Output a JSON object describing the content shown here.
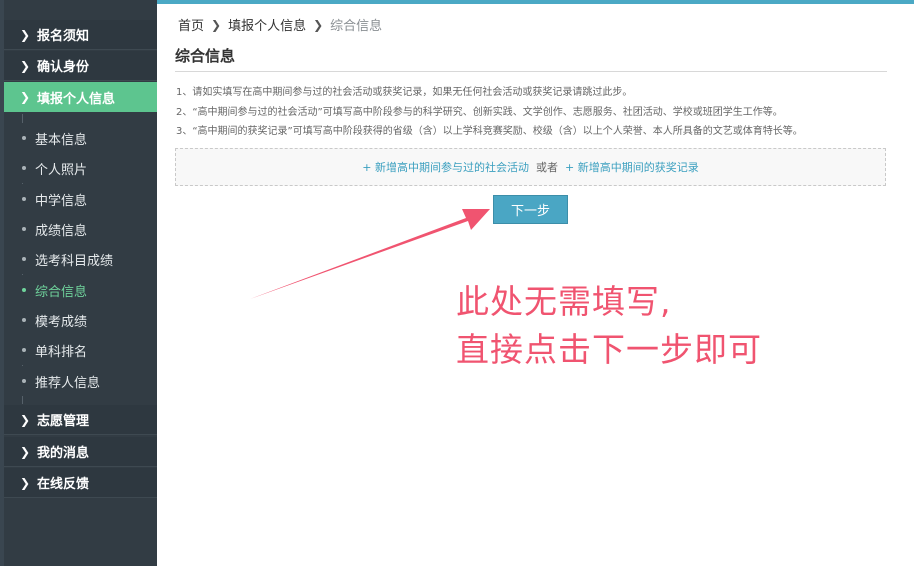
{
  "sidebar": {
    "items": [
      {
        "label": "报名须知",
        "type": "section",
        "active": false
      },
      {
        "label": "确认身份",
        "type": "section",
        "active": false
      },
      {
        "label": "填报个人信息",
        "type": "section",
        "active": true
      },
      {
        "label": "基本信息",
        "type": "sub",
        "current": false
      },
      {
        "label": "个人照片",
        "type": "sub",
        "current": false
      },
      {
        "label": "中学信息",
        "type": "sub",
        "current": false
      },
      {
        "label": "成绩信息",
        "type": "sub",
        "current": false
      },
      {
        "label": "选考科目成绩",
        "type": "sub",
        "current": false
      },
      {
        "label": "综合信息",
        "type": "sub",
        "current": true
      },
      {
        "label": "模考成绩",
        "type": "sub",
        "current": false
      },
      {
        "label": "单科排名",
        "type": "sub",
        "current": false
      },
      {
        "label": "推荐人信息",
        "type": "sub",
        "current": false
      },
      {
        "label": "志愿管理",
        "type": "section",
        "active": false
      },
      {
        "label": "我的消息",
        "type": "section",
        "active": false
      },
      {
        "label": "在线反馈",
        "type": "section",
        "active": false
      }
    ]
  },
  "breadcrumb": {
    "home": "首页",
    "parent": "填报个人信息",
    "current": "综合信息"
  },
  "page": {
    "title": "综合信息",
    "notes": [
      "1、请如实填写在高中期间参与过的社会活动或获奖记录，如果无任何社会活动或获奖记录请跳过此步。",
      "2、“高中期间参与过的社会活动”可填写高中阶段参与的科学研究、创新实践、文学创作、志愿服务、社团活动、学校或班团学生工作等。",
      "3、“高中期间的获奖记录”可填写高中阶段获得的省级（含）以上学科竞赛奖励、校级（含）以上个人荣誉、本人所具备的文艺或体育特长等。"
    ],
    "add_activity": "+ 新增高中期间参与过的社会活动",
    "or": "或者",
    "add_award": "+ 新增高中期间的获奖记录",
    "next_button": "下一步"
  },
  "annotation": {
    "line1": "此处无需填写,",
    "line2": "直接点击下一步即可"
  },
  "colors": {
    "sidebar_bg": "#323c44",
    "active_green": "#5dc58f",
    "button_blue": "#4aa6c4",
    "link_blue": "#3a9fbf",
    "annotation_red": "#f05470"
  }
}
